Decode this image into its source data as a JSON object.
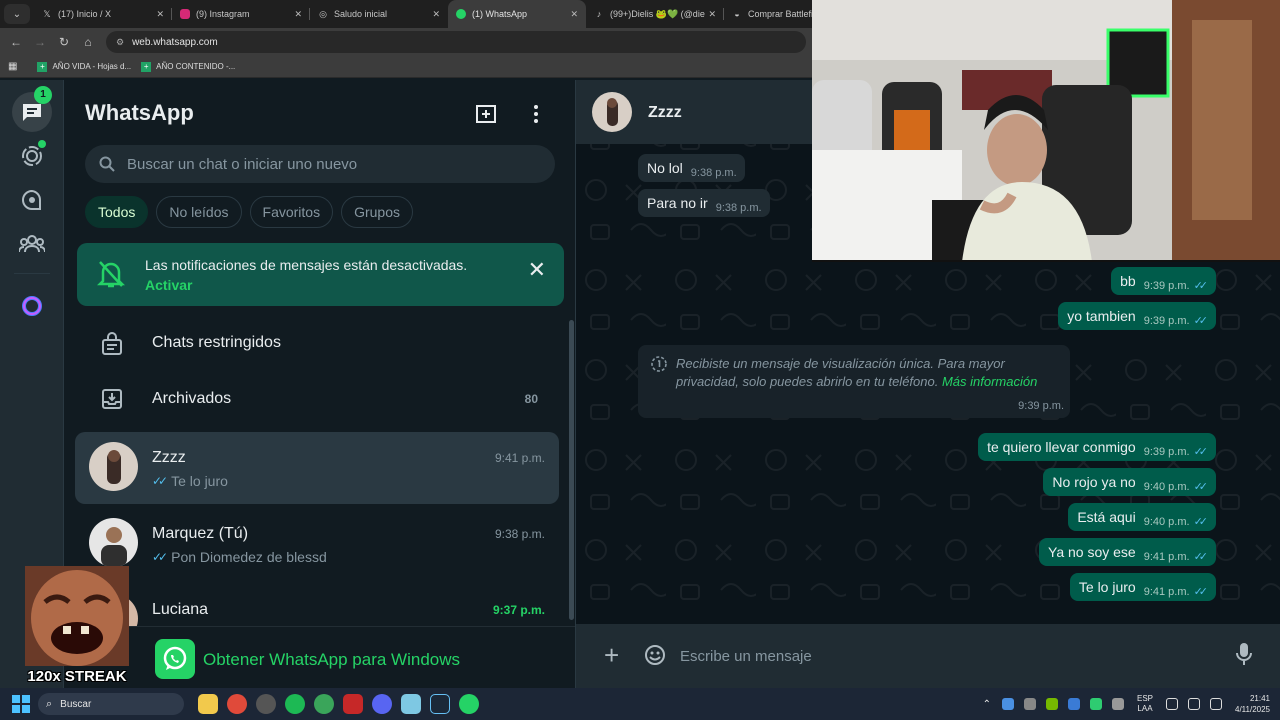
{
  "browser": {
    "tabs": [
      {
        "label": "(17) Inicio / X",
        "icon": "x-logo-icon",
        "active": false
      },
      {
        "label": "(9) Instagram",
        "icon": "instagram-icon",
        "active": false
      },
      {
        "label": "Saludo inicial",
        "icon": "globe-icon",
        "active": false
      },
      {
        "label": "(1) WhatsApp",
        "icon": "whatsapp-icon",
        "active": true
      },
      {
        "label": "(99+)Dielis 🐸💚 (@die",
        "icon": "tiktok-icon",
        "active": false
      },
      {
        "label": "Comprar Battlefield",
        "icon": "ea-icon",
        "active": false
      }
    ],
    "url": "web.whatsapp.com",
    "bookmarks": [
      "AÑO VIDA - Hojas d...",
      "AÑO CONTENIDO -..."
    ]
  },
  "rail": {
    "chats_badge": "1"
  },
  "sidebar": {
    "title": "WhatsApp",
    "search_placeholder": "Buscar un chat o iniciar uno nuevo",
    "filters": [
      "Todos",
      "No leídos",
      "Favoritos",
      "Grupos"
    ],
    "notification": {
      "text": "Las notificaciones de mensajes están desactivadas.",
      "action": "Activar"
    },
    "restricted_label": "Chats restringidos",
    "archived_label": "Archivados",
    "archived_count": "80",
    "chats": [
      {
        "name": "Zzzz",
        "time": "9:41 p.m.",
        "preview": "Te lo juro",
        "selected": true,
        "unread": false
      },
      {
        "name": "Marquez (Tú)",
        "time": "9:38 p.m.",
        "preview": "Pon Diomedez de blessd",
        "selected": false,
        "unread": false
      },
      {
        "name": "Luciana",
        "time": "9:37 p.m.",
        "preview": "",
        "selected": false,
        "unread": true
      }
    ],
    "get_windows": "Obtener WhatsApp para Windows"
  },
  "conversation": {
    "contact_name": "Zzzz",
    "incoming": [
      {
        "text": "No lol",
        "time": "9:38 p.m."
      },
      {
        "text": "Para no ir",
        "time": "9:38 p.m."
      }
    ],
    "outgoing_top": [
      {
        "text": "bb",
        "time": "9:39 p.m."
      },
      {
        "text": "yo tambien",
        "time": "9:39 p.m."
      }
    ],
    "view_once": {
      "text": "Recibiste un mensaje de visualización única. Para mayor privacidad, solo puedes abrirlo en tu teléfono.",
      "link": "Más información",
      "time": "9:39 p.m."
    },
    "outgoing_bottom": [
      {
        "text": "te quiero llevar conmigo",
        "time": "9:39 p.m."
      },
      {
        "text": "No rojo ya no",
        "time": "9:40 p.m."
      },
      {
        "text": "Está aqui",
        "time": "9:40 p.m."
      },
      {
        "text": "Ya no soy ese",
        "time": "9:41 p.m."
      },
      {
        "text": "Te lo juro",
        "time": "9:41 p.m."
      }
    ],
    "composer_placeholder": "Escribe un mensaje"
  },
  "overlay": {
    "streak_label": "120x STREAK"
  },
  "taskbar": {
    "search_label": "Buscar",
    "lang_line1": "ESP",
    "lang_line2": "LAA",
    "clock_time": "21:41",
    "clock_date": "4/11/2025"
  },
  "colors": {
    "accent": "#25d366",
    "outgoing_bubble": "#005c4b",
    "incoming_bubble": "#202c33",
    "read_ticks": "#53bdeb"
  }
}
